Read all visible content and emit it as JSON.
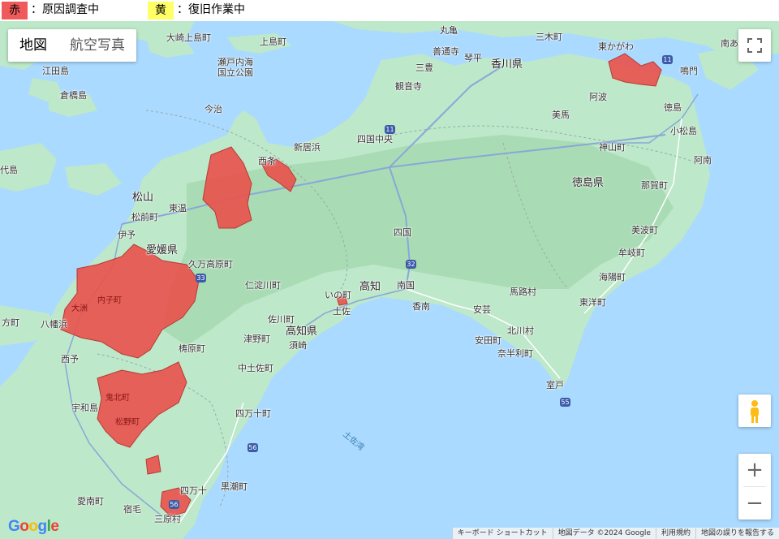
{
  "legend": [
    {
      "swatch": "赤",
      "text": "：原因調査中",
      "color": "#f05a5a"
    },
    {
      "swatch": "黄",
      "text": "：復旧作業中",
      "color": "#ffff66"
    }
  ],
  "map_type": {
    "map_label": "地図",
    "satellite_label": "航空写真"
  },
  "controls": {
    "fullscreen_icon": "fullscreen-icon",
    "zoom_in": "+",
    "zoom_out": "−",
    "pegman_icon": "pegman-icon"
  },
  "colors": {
    "sea": "#aadaff",
    "land": "#bde8c9",
    "outage": "#e8544e",
    "outage_border": "#b83a35"
  },
  "attribution": {
    "logo": "Google",
    "items": [
      "キーボード ショートカット",
      "地図データ ©2024 Google",
      "利用規約",
      "地図の誤りを報告する"
    ]
  },
  "labels": {
    "ohmishima": "大崎上島町",
    "kamijima": "上島町",
    "setonaikai": "瀬戸内海",
    "kokuritsu": "国立公園",
    "etajima": "江田島",
    "kurahashi": "倉橋島",
    "imabari": "今治",
    "yashiro": "代島",
    "niihama": "新居浜",
    "saijo": "西条",
    "shikokuchuo": "四国中央",
    "matsuyama": "松山",
    "toon": "東温",
    "masaki": "松前町",
    "iyo": "伊予",
    "ehime": "愛媛県",
    "kumakogen": "久万高原町",
    "niyodogawa": "仁淀川町",
    "uchiko": "内子町",
    "ozu": "大洲",
    "hachimanhama": "八幡浜",
    "hokata": "方町",
    "seiyo": "西予",
    "sakawa": "佐川町",
    "tsuno": "津野町",
    "yusuhara": "梼原町",
    "kochiken": "高知県",
    "susaki": "須崎",
    "nakatosa": "中土佐町",
    "kihoku": "鬼北町",
    "uwajima": "宇和島",
    "matsuno": "松野町",
    "shimanto_cho": "四万十町",
    "ainan": "愛南町",
    "sukumo": "宿毛",
    "mihara": "三原村",
    "shimanto": "四万十",
    "kuroshio": "黒潮町",
    "tosawan": "土佐湾",
    "ino": "いの町",
    "kochi": "高知",
    "nankoku": "南国",
    "tosa": "土佐",
    "konan": "香南",
    "aki": "安芸",
    "yasuda": "安田町",
    "nahari": "奈半利町",
    "kitagawa": "北川村",
    "umaji": "馬路村",
    "toyo": "東洋町",
    "muroto": "室戸",
    "kaiyo": "海陽町",
    "mugi": "牟岐町",
    "minami": "美波町",
    "nakasu": "那賀町",
    "anan": "阿南",
    "tokushimaken": "徳島県",
    "kamiyama": "神山町",
    "mima": "美馬",
    "awa": "阿波",
    "tokushima": "徳島",
    "komatsushima": "小松島",
    "higashikagawa": "東かがわ",
    "naruto": "鳴門",
    "kagawaken": "香川県",
    "mitoyo": "三豊",
    "kanonji": "観音寺",
    "zentsuji": "善通寺",
    "kotohira": "琴平",
    "marugame": "丸亀",
    "miki": "三木町",
    "shikoku": "四国",
    "uchiumi": "内海",
    "kochi2": "鬼北町",
    "nanao": "南あ"
  },
  "route_shields": [
    "11",
    "11",
    "32",
    "33",
    "55",
    "56",
    "56"
  ]
}
